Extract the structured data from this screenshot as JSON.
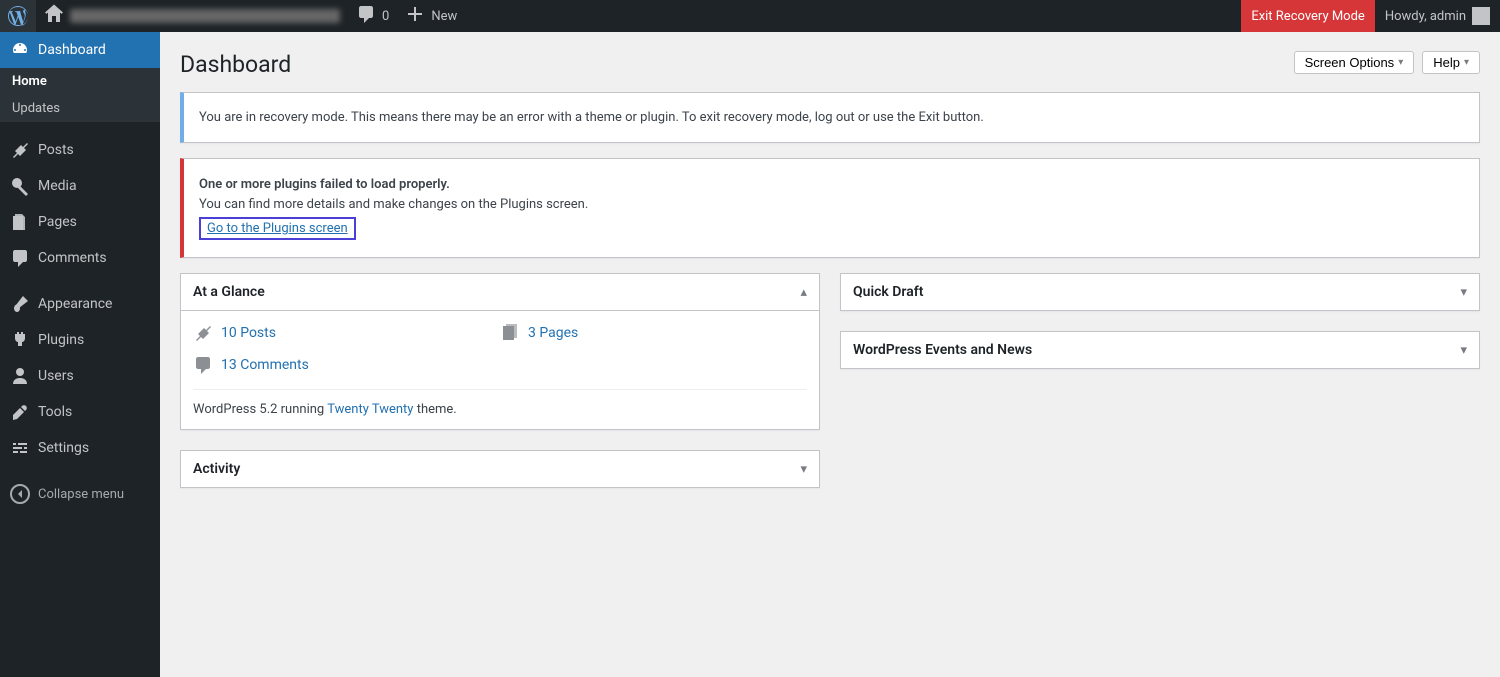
{
  "topbar": {
    "comments_count": "0",
    "new_label": "New",
    "exit_recovery": "Exit Recovery Mode",
    "howdy": "Howdy, admin"
  },
  "sidebar": {
    "dashboard": "Dashboard",
    "home": "Home",
    "updates": "Updates",
    "posts": "Posts",
    "media": "Media",
    "pages": "Pages",
    "comments": "Comments",
    "appearance": "Appearance",
    "plugins": "Plugins",
    "users": "Users",
    "tools": "Tools",
    "settings": "Settings",
    "collapse": "Collapse menu"
  },
  "header": {
    "title": "Dashboard",
    "screen_options": "Screen Options",
    "help": "Help"
  },
  "notices": {
    "recovery": "You are in recovery mode. This means there may be an error with a theme or plugin. To exit recovery mode, log out or use the Exit button.",
    "error_title": "One or more plugins failed to load properly.",
    "error_detail": "You can find more details and make changes on the Plugins screen.",
    "error_link": "Go to the Plugins screen"
  },
  "glance": {
    "title": "At a Glance",
    "posts": "10 Posts",
    "pages": "3 Pages",
    "comments": "13 Comments",
    "version_prefix": "WordPress 5.2 running ",
    "theme": "Twenty Twenty",
    "version_suffix": " theme."
  },
  "activity": {
    "title": "Activity"
  },
  "quick_draft": {
    "title": "Quick Draft"
  },
  "events": {
    "title": "WordPress Events and News"
  }
}
